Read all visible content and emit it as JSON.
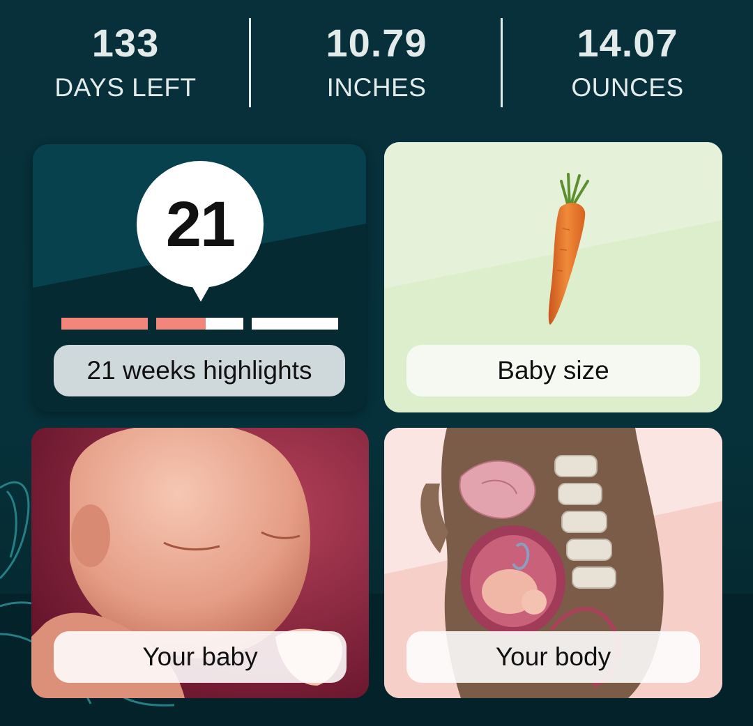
{
  "stats": [
    {
      "value": "133",
      "label": "DAYS LEFT"
    },
    {
      "value": "10.79",
      "label": "INCHES"
    },
    {
      "value": "14.07",
      "label": "OUNCES"
    }
  ],
  "highlights": {
    "week_number": "21",
    "trimester_progress": [
      1.0,
      0.57,
      0.0
    ],
    "label": "21 weeks highlights"
  },
  "baby_size": {
    "label": "Baby size",
    "fruit": "carrot"
  },
  "your_baby": {
    "label": "Your baby"
  },
  "your_body": {
    "label": "Your body"
  },
  "colors": {
    "background": "#062a31",
    "progress_fill": "#f0877a",
    "baby_size_card": "#dfeed1",
    "your_body_card": "#f6d6d3"
  }
}
